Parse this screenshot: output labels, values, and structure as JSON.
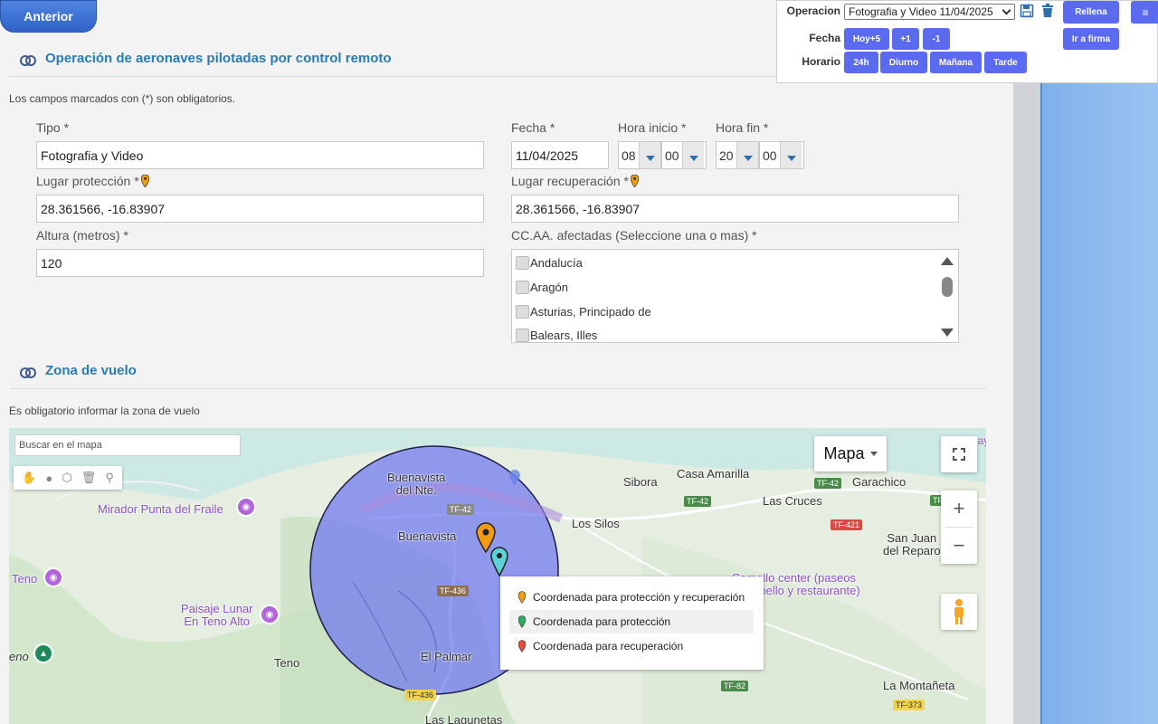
{
  "nav": {
    "back_label": "Anterior"
  },
  "panel": {
    "operacion_label": "Operacion",
    "operacion_value": "Fotografia y Video 11/04/2025",
    "fecha_label": "Fecha",
    "horario_label": "Horario",
    "btn_rellena": "Rellena",
    "btn_menu": "≡",
    "btn_ir_firma": "Ir a firma",
    "fecha_buttons": [
      "Hoy+5",
      "+1",
      "-1"
    ],
    "horario_buttons": [
      "24h",
      "Diurno",
      "Mañana",
      "Tarde"
    ]
  },
  "section1": {
    "title": "Operación de aeronaves pilotadas por control remoto",
    "note": "Los campos marcados con (*) son obligatorios."
  },
  "form": {
    "tipo_label": "Tipo",
    "tipo_value": "Fotografia y Video",
    "fecha_label": "Fecha",
    "fecha_value": "11/04/2025",
    "hora_inicio_label": "Hora inicio",
    "hora_inicio_h": "08",
    "hora_inicio_m": "00",
    "hora_fin_label": "Hora fin",
    "hora_fin_h": "20",
    "hora_fin_m": "00",
    "lugar_proteccion_label": "Lugar protección",
    "lugar_proteccion_value": "28.361566, -16.83907",
    "lugar_recuperacion_label": "Lugar recuperación",
    "lugar_recuperacion_value": "28.361566, -16.83907",
    "altura_label": "Altura (metros)",
    "altura_value": "120",
    "ccaa_label": "CC.AA. afectadas (Seleccione una o mas)",
    "ccaa_options": [
      "Andalucía",
      "Aragón",
      "Asturias, Principado de",
      "Balears, Illes"
    ],
    "required_mark": "*"
  },
  "section2": {
    "title": "Zona de vuelo",
    "note": "Es obligatorio informar la zona de vuelo"
  },
  "map": {
    "search_placeholder": "Buscar en el mapa",
    "type_label": "Mapa",
    "zoom_in": "+",
    "zoom_out": "−",
    "places": {
      "buenavista_nte": "Buenavista\ndel Nte.",
      "buenavista": "Buenavista",
      "sibora": "Sibora",
      "casa_amarilla": "Casa Amarilla",
      "garachico": "Garachico",
      "las_cruces": "Las Cruces",
      "los_silos": "Los Silos",
      "san_juan": "San Juan\ndel Reparo",
      "mirador": "Mirador Punta del Fraile",
      "teno_left": "Teno",
      "paisaje": "Paisaje Lunar\nEn Teno Alto",
      "teno": "Teno",
      "el_palmar": "El Palmar",
      "la_montaneta": "La Montañeta",
      "las_lagunetas": "Las Lagunetas",
      "camello": "Camello center (paseos\nen camello y restaurante)",
      "eno": "eno",
      "play": "Play"
    },
    "roads": {
      "tf42a": "TF-42",
      "tf42b": "TF-42",
      "tf42c": "TF-42",
      "tf42d": "TF",
      "tf421": "TF-421",
      "tf436a": "TF-436",
      "tf436b": "TF-436",
      "tf82": "TF-82",
      "tf373": "TF-373"
    },
    "legend": [
      {
        "label": "Coordenada para protección y recuperación",
        "color": "#f39c12"
      },
      {
        "label": "Coordenada para protección",
        "color": "#27ae60"
      },
      {
        "label": "Coordenada para recuperación",
        "color": "#e74c3c"
      }
    ]
  }
}
